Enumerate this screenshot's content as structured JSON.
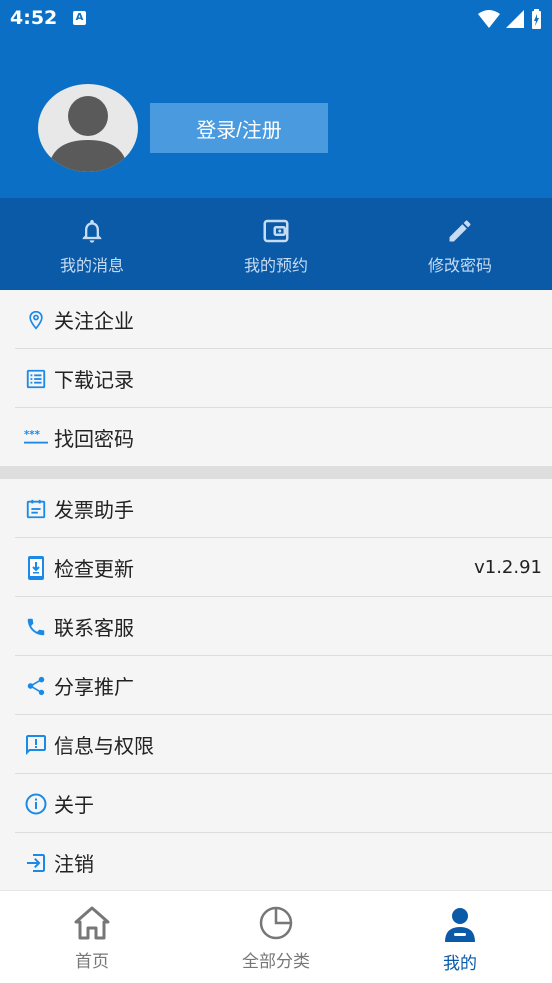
{
  "status": {
    "time": "4:52",
    "badge": "A"
  },
  "header": {
    "login_label": "登录/注册"
  },
  "quick": [
    {
      "label": "我的消息",
      "icon": "bell-icon"
    },
    {
      "label": "我的预约",
      "icon": "wallet-icon"
    },
    {
      "label": "修改密码",
      "icon": "pencil-icon"
    }
  ],
  "menu_group1": [
    {
      "label": "关注企业",
      "icon": "location-pin-icon"
    },
    {
      "label": "下载记录",
      "icon": "list-icon"
    },
    {
      "label": "找回密码",
      "icon": "password-icon"
    }
  ],
  "menu_group2": [
    {
      "label": "发票助手",
      "icon": "invoice-icon"
    },
    {
      "label": "检查更新",
      "icon": "update-icon",
      "value": "v1.2.91"
    },
    {
      "label": "联系客服",
      "icon": "phone-icon"
    },
    {
      "label": "分享推广",
      "icon": "share-icon"
    },
    {
      "label": "信息与权限",
      "icon": "feedback-icon"
    },
    {
      "label": "关于",
      "icon": "info-icon"
    },
    {
      "label": "注销",
      "icon": "logout-icon"
    }
  ],
  "tabs": [
    {
      "label": "首页",
      "icon": "home-icon",
      "active": false
    },
    {
      "label": "全部分类",
      "icon": "pie-chart-icon",
      "active": false
    },
    {
      "label": "我的",
      "icon": "user-icon",
      "active": true
    }
  ],
  "colors": {
    "primary": "#0a6fc5",
    "primary_dark": "#0a5aa8",
    "icon_blue": "#1a8ae6"
  }
}
